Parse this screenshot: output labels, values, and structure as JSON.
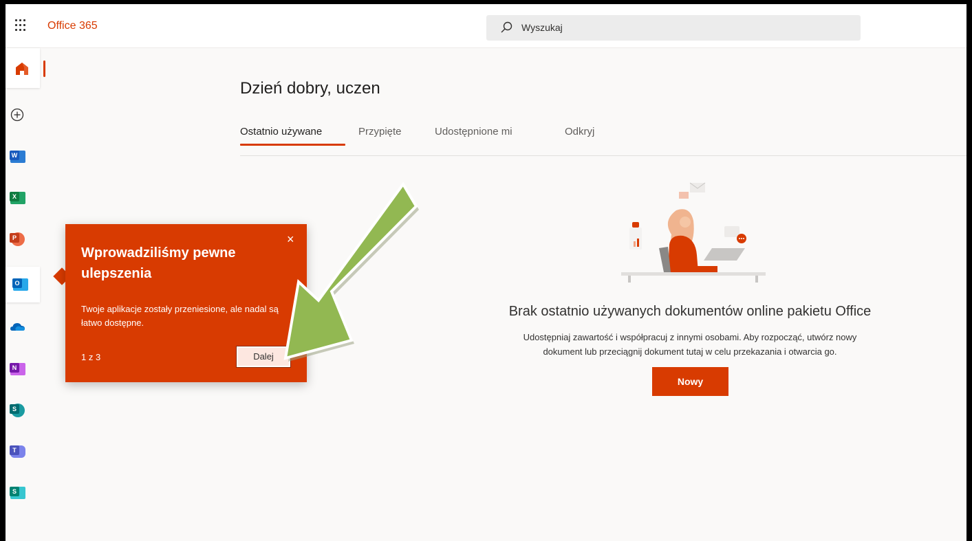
{
  "app": {
    "brand": "Office 365"
  },
  "search": {
    "placeholder": "Wyszukaj"
  },
  "rail": {
    "items": [
      {
        "name": "home-icon"
      },
      {
        "name": "create-icon"
      },
      {
        "name": "word-icon",
        "letter": "W",
        "color": "#185abd"
      },
      {
        "name": "excel-icon",
        "letter": "X",
        "color": "#107c41"
      },
      {
        "name": "powerpoint-icon",
        "letter": "P",
        "color": "#c43e1c"
      },
      {
        "name": "outlook-icon",
        "letter": "O",
        "color": "#0364b8"
      },
      {
        "name": "onedrive-icon"
      },
      {
        "name": "onenote-icon",
        "letter": "N",
        "color": "#7719aa"
      },
      {
        "name": "sharepoint-icon",
        "letter": "S",
        "color": "#036c70"
      },
      {
        "name": "teams-icon",
        "letter": "T",
        "color": "#4b53bc"
      },
      {
        "name": "sway-icon",
        "letter": "S",
        "color": "#008272"
      }
    ]
  },
  "main": {
    "greeting": "Dzień dobry, uczen",
    "tabs": [
      {
        "label": "Ostatnio używane",
        "active": true
      },
      {
        "label": "Przypięte"
      },
      {
        "label": "Udostępnione mi"
      },
      {
        "label": "Odkryj"
      }
    ],
    "empty": {
      "title": "Brak ostatnio używanych dokumentów online pakietu Office",
      "line1": "Udostępniaj zawartość i współpracuj z innymi osobami. Aby rozpocząć, utwórz nowy",
      "line2": "dokument lub przeciągnij dokument tutaj w celu przekazania i otwarcia go.",
      "button": "Nowy"
    }
  },
  "popup": {
    "title": "Wprowadziliśmy pewne ulepszenia",
    "body": "Twoje aplikacje zostały przeniesione, ale nadal są łatwo dostępne.",
    "count": "1 z 3",
    "next": "Dalej",
    "close": "×"
  },
  "colors": {
    "accent": "#d83b01",
    "arrow": "#92b852"
  }
}
